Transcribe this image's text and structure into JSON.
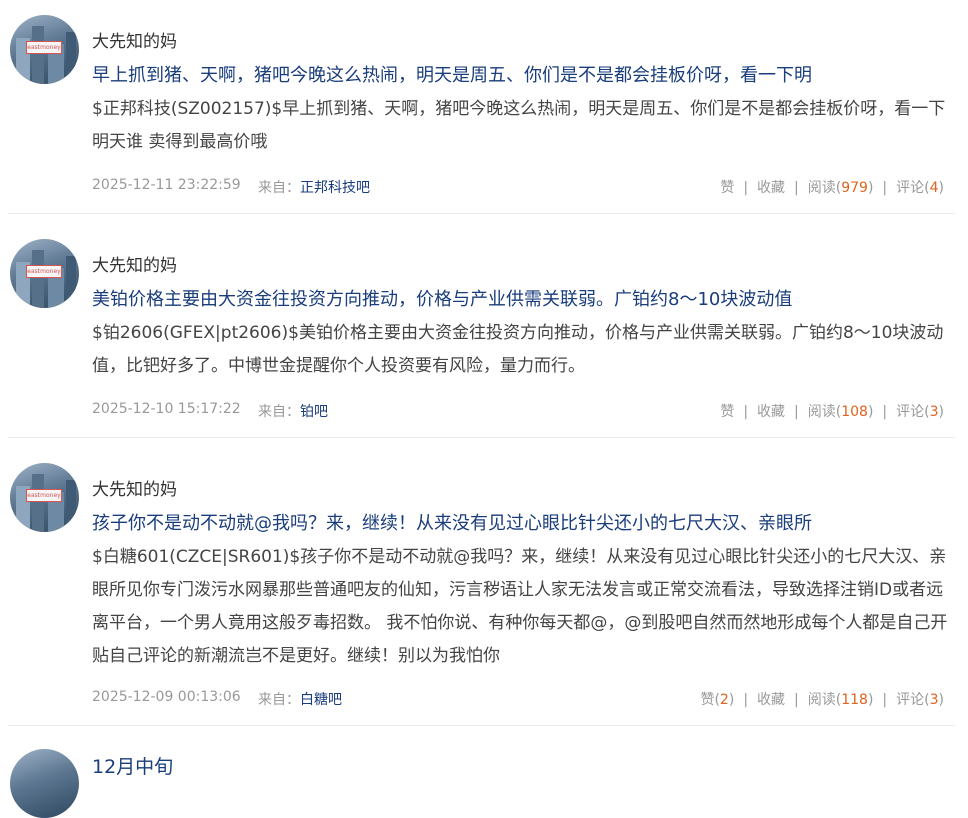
{
  "posts": [
    {
      "author": "大先知的妈",
      "title": "早上抓到猪、天啊，猪吧今晚这么热闹，明天是周五、你们是不是都会挂板价呀，看一下明",
      "content": "$正邦科技(SZ002157)$早上抓到猪、天啊，猪吧今晚这么热闹，明天是周五、你们是不是都会挂板价呀，看一下明天谁 卖得到最高价哦",
      "date": "2025-12-11 23:22:59",
      "from_label": "来自：",
      "forum": "正邦科技吧",
      "like_label": "赞",
      "like_count": "",
      "fav_label": "收藏",
      "read_label": "阅读",
      "read_count": "979",
      "comment_label": "评论",
      "comment_count": "4"
    },
    {
      "author": "大先知的妈",
      "title": "美铂价格主要由大资金往投资方向推动，价格与产业供需关联弱。广铂约8～10块波动值",
      "content": "$铂2606(GFEX|pt2606)$美铂价格主要由大资金往投资方向推动，价格与产业供需关联弱。广铂约8～10块波动值，比钯好多了。中博世金提醒你个人投资要有风险，量力而行。",
      "date": "2025-12-10 15:17:22",
      "from_label": "来自：",
      "forum": "铂吧",
      "like_label": "赞",
      "like_count": "",
      "fav_label": "收藏",
      "read_label": "阅读",
      "read_count": "108",
      "comment_label": "评论",
      "comment_count": "3"
    },
    {
      "author": "大先知的妈",
      "title": "孩子你不是动不动就@我吗？来，继续！从来没有见过心眼比针尖还小的七尺大汉、亲眼所",
      "content": "$白糖601(CZCE|SR601)$孩子你不是动不动就@我吗？来，继续！从来没有见过心眼比针尖还小的七尺大汉、亲眼所见你专门泼污水网暴那些普通吧友的仙知，污言秽语让人家无法发言或正常交流看法，导致选择注销ID或者远离平台，一个男人竟用这般歹毒招数。 我不怕你说、有种你每天都@，@到股吧自然而然地形成每个人都是自己开贴自己评论的新潮流岂不是更好。继续！别以为我怕你",
      "date": "2025-12-09 00:13:06",
      "from_label": "来自：",
      "forum": "白糖吧",
      "like_label": "赞",
      "like_count": "2",
      "fav_label": "收藏",
      "read_label": "阅读",
      "read_count": "118",
      "comment_label": "评论",
      "comment_count": "3"
    }
  ],
  "partial_post": {
    "title": "12月中旬"
  },
  "avatar_tag": "eastmoney"
}
